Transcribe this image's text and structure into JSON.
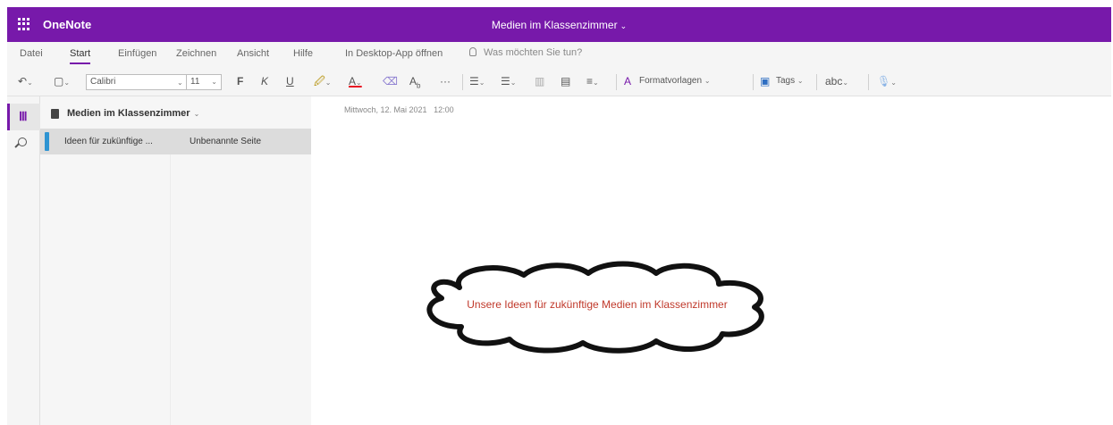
{
  "app": {
    "name": "OneNote",
    "document_title": "Medien im Klassenzimmer",
    "brand_color": "#7719aa"
  },
  "menu": {
    "tabs": [
      {
        "label": "Datei"
      },
      {
        "label": "Start",
        "active": true
      },
      {
        "label": "Einfügen"
      },
      {
        "label": "Zeichnen"
      },
      {
        "label": "Ansicht"
      },
      {
        "label": "Hilfe"
      },
      {
        "label": "In Desktop-App öffnen"
      }
    ],
    "tell_me_placeholder": "Was möchten Sie tun?"
  },
  "ribbon": {
    "font_name": "Calibri",
    "font_size": "11",
    "bold": "F",
    "italic": "K",
    "underline": "U",
    "styles_label": "Formatvorlagen",
    "tags_label": "Tags",
    "more": "···",
    "font_color": "#e81123",
    "highlight_color": "#ffd800"
  },
  "notebook": {
    "title": "Medien im Klassenzimmer",
    "sections": [
      {
        "label": "Ideen für zukünftige ...",
        "color": "#2e94d2"
      }
    ],
    "pages": [
      {
        "label": "Unbenannte Seite"
      }
    ]
  },
  "page": {
    "date": "Mittwoch, 12. Mai 2021",
    "time": "12:00",
    "cloud_text": "Unsere Ideen für zukünftige Medien im Klassenzimmer",
    "cloud_text_color": "#c0392b"
  }
}
